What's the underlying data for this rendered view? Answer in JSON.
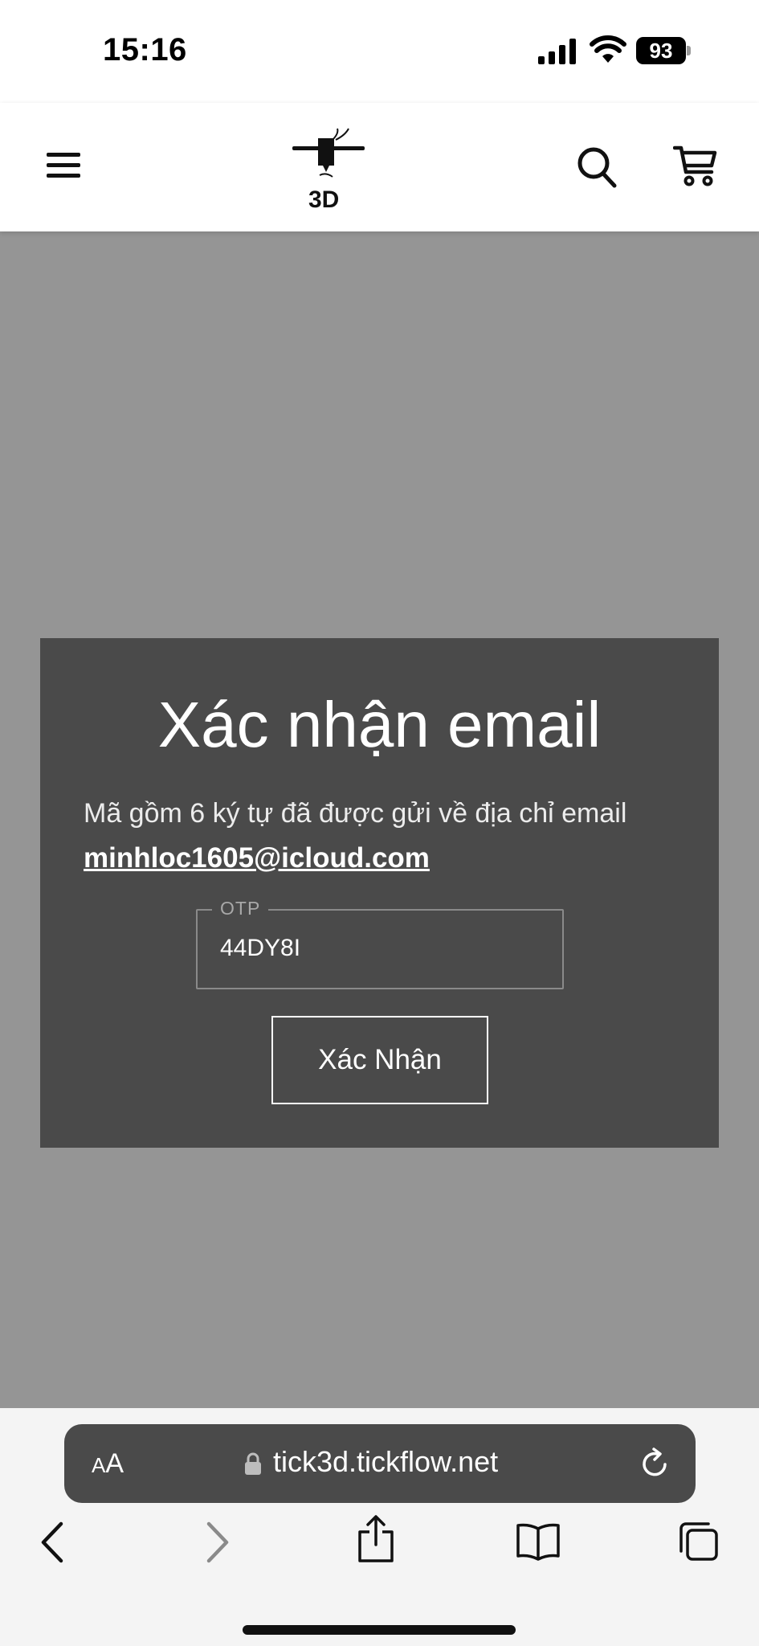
{
  "status_bar": {
    "time": "15:16",
    "battery": "93",
    "icons": [
      "signal-icon",
      "wifi-icon",
      "battery-icon"
    ]
  },
  "header": {
    "logo_text": "3D",
    "icons": [
      "menu-icon",
      "search-icon",
      "cart-icon"
    ]
  },
  "modal": {
    "title": "Xác nhận email",
    "description": "Mã gồm 6 ký tự đã được gửi về địa chỉ email",
    "email": "minhloc1605@icloud.com",
    "otp_label": "OTP",
    "otp_value": "44DY8I",
    "confirm_label": "Xác Nhận"
  },
  "browser": {
    "aa_small": "A",
    "aa_big": "A",
    "url": "tick3d.tickflow.net",
    "icons": [
      "lock-icon",
      "reload-icon",
      "back-icon",
      "forward-icon",
      "share-icon",
      "bookmarks-icon",
      "tabs-icon"
    ]
  },
  "colors": {
    "overlay": "#959595",
    "modal_bg": "#4a4a4a",
    "header_bg": "#ffffff",
    "url_bar_bg": "#4a4a4a"
  }
}
